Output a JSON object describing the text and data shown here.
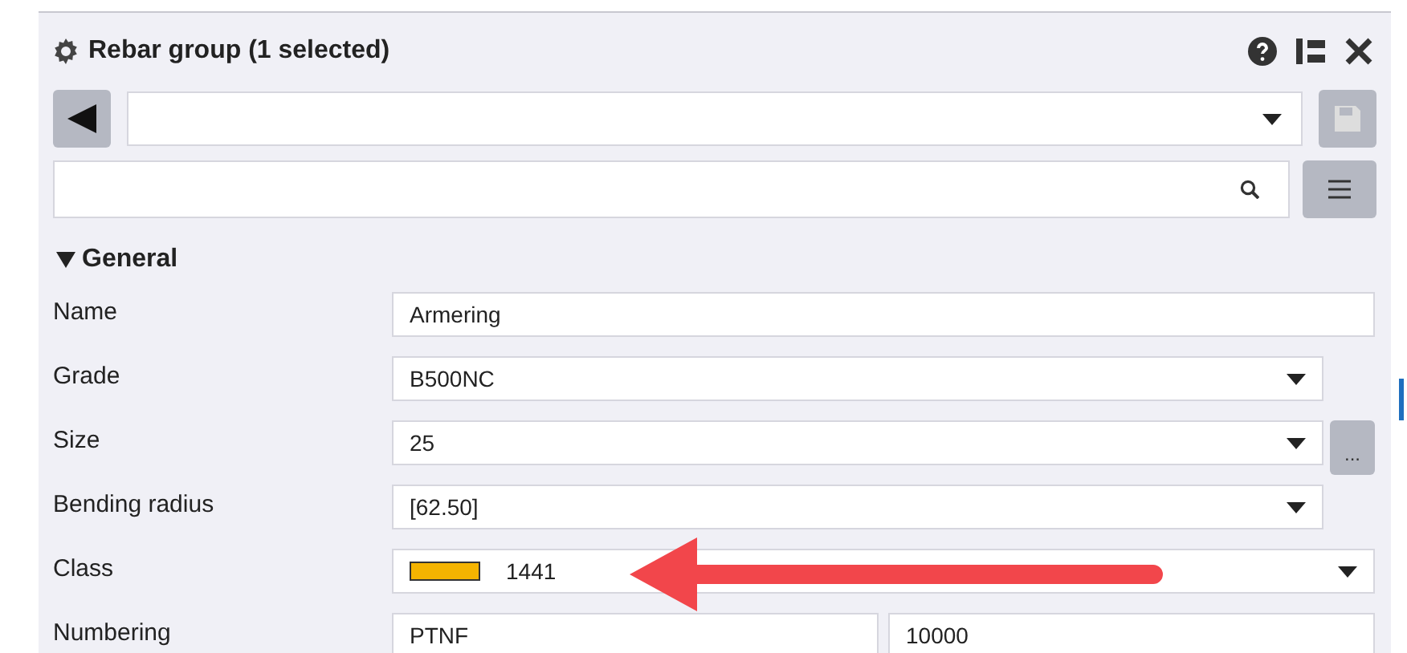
{
  "panel": {
    "title": "Rebar group (1 selected)"
  },
  "section": {
    "title": "General",
    "expanded": true,
    "rows": [
      {
        "kind": "text",
        "label": "Name",
        "value": "Armering"
      },
      {
        "kind": "dropdown",
        "label": "Grade",
        "value": "B500NC"
      },
      {
        "kind": "dropdown-button",
        "label": "Size",
        "value": "25",
        "button": "..."
      },
      {
        "kind": "dropdown",
        "label": "Bending radius",
        "value": "[62.50]"
      },
      {
        "kind": "color-dropdown",
        "label": "Class",
        "value": "1441",
        "color": "#f5b400"
      },
      {
        "kind": "pair",
        "label": "Numbering",
        "value": "PTNF",
        "value2": "10000"
      }
    ]
  }
}
